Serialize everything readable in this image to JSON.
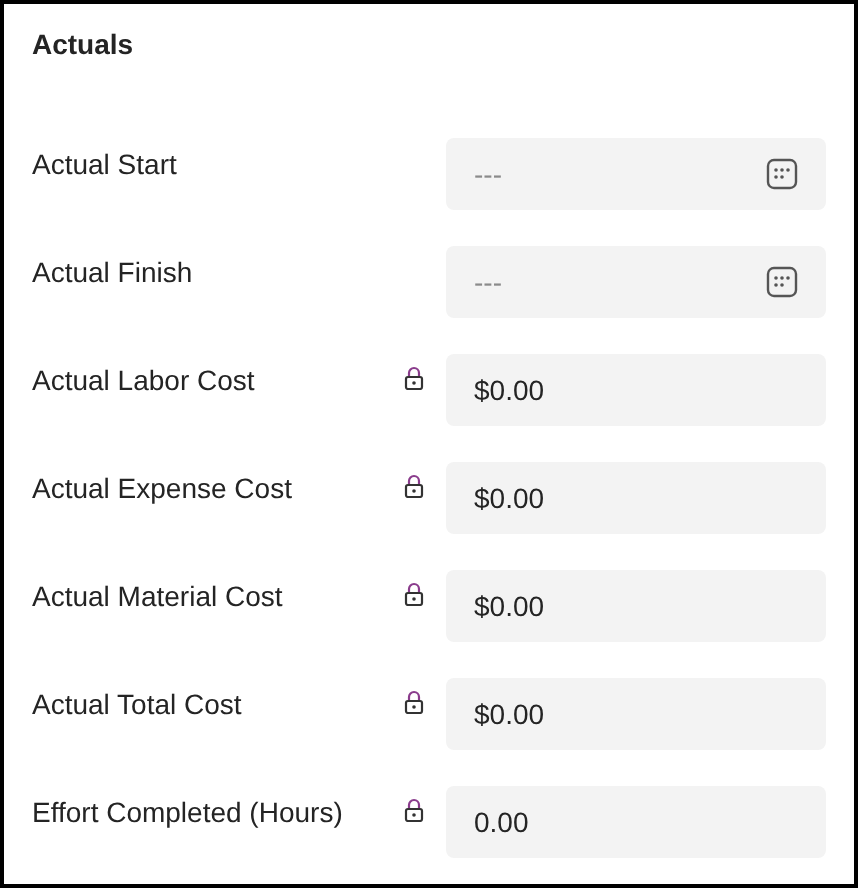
{
  "section": {
    "title": "Actuals"
  },
  "fields": [
    {
      "kind": "date",
      "label": "Actual Start",
      "placeholder": "---"
    },
    {
      "kind": "date",
      "label": "Actual Finish",
      "placeholder": "---"
    },
    {
      "kind": "locked",
      "label": "Actual Labor Cost",
      "value": "$0.00"
    },
    {
      "kind": "locked",
      "label": "Actual Expense Cost",
      "value": "$0.00"
    },
    {
      "kind": "locked",
      "label": "Actual Material Cost",
      "value": "$0.00"
    },
    {
      "kind": "locked",
      "label": "Actual Total Cost",
      "value": "$0.00"
    },
    {
      "kind": "locked",
      "label": "Effort Completed (Hours)",
      "value": "0.00"
    }
  ]
}
